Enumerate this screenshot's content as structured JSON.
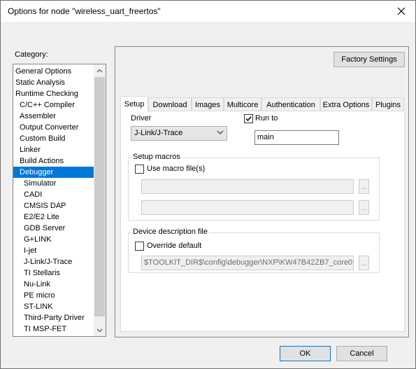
{
  "window": {
    "title": "Options for node \"wireless_uart_freertos\""
  },
  "category": {
    "label": "Category:",
    "items": [
      {
        "label": "General Options",
        "level": 0
      },
      {
        "label": "Static Analysis",
        "level": 0
      },
      {
        "label": "Runtime Checking",
        "level": 0
      },
      {
        "label": "C/C++ Compiler",
        "level": 1
      },
      {
        "label": "Assembler",
        "level": 1
      },
      {
        "label": "Output Converter",
        "level": 1
      },
      {
        "label": "Custom Build",
        "level": 1
      },
      {
        "label": "Linker",
        "level": 1
      },
      {
        "label": "Build Actions",
        "level": 1
      },
      {
        "label": "Debugger",
        "level": 1,
        "selected": true
      },
      {
        "label": "Simulator",
        "level": 2
      },
      {
        "label": "CADI",
        "level": 2
      },
      {
        "label": "CMSIS DAP",
        "level": 2
      },
      {
        "label": "E2/E2 Lite",
        "level": 2
      },
      {
        "label": "GDB Server",
        "level": 2
      },
      {
        "label": "G+LINK",
        "level": 2
      },
      {
        "label": "I-jet",
        "level": 2
      },
      {
        "label": "J-Link/J-Trace",
        "level": 2
      },
      {
        "label": "TI Stellaris",
        "level": 2
      },
      {
        "label": "Nu-Link",
        "level": 2
      },
      {
        "label": "PE micro",
        "level": 2
      },
      {
        "label": "ST-LINK",
        "level": 2
      },
      {
        "label": "Third-Party Driver",
        "level": 2
      },
      {
        "label": "TI MSP-FET",
        "level": 2
      }
    ]
  },
  "buttons": {
    "factory_settings": "Factory Settings",
    "ok": "OK",
    "cancel": "Cancel",
    "ellipsis": "..."
  },
  "tabs": [
    {
      "label": "Setup",
      "active": true
    },
    {
      "label": "Download"
    },
    {
      "label": "Images"
    },
    {
      "label": "Multicore"
    },
    {
      "label": "Authentication"
    },
    {
      "label": "Extra Options"
    },
    {
      "label": "Plugins"
    }
  ],
  "setup": {
    "driver_label": "Driver",
    "driver_value": "J-Link/J-Trace",
    "run_to_label": "Run to",
    "run_to_checked": true,
    "run_to_value": "main",
    "setup_macros_title": "Setup macros",
    "use_macro_label": "Use macro file(s)",
    "use_macro_checked": false,
    "device_desc_title": "Device description file",
    "override_label": "Override default",
    "override_checked": false,
    "device_desc_path": "$TOOLKIT_DIR$\\config\\debugger\\NXP\\KW47B42ZB7_core0"
  }
}
